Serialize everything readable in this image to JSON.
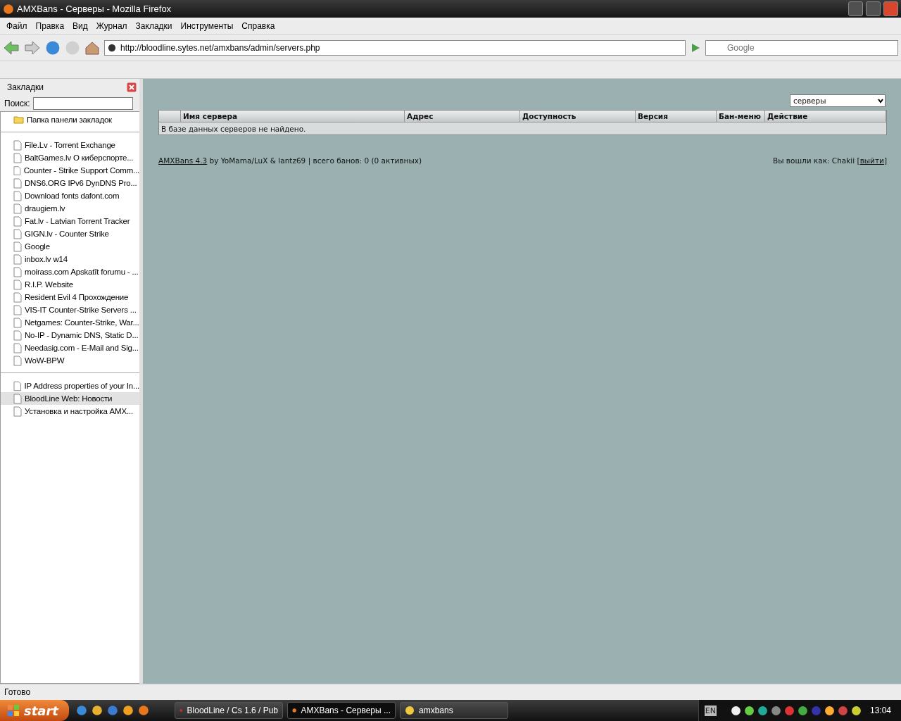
{
  "window": {
    "title": "AMXBans - Серверы - Mozilla Firefox"
  },
  "menu": [
    "Файл",
    "Правка",
    "Вид",
    "Журнал",
    "Закладки",
    "Инструменты",
    "Справка"
  ],
  "address": {
    "value": "http://bloodline.sytes.net/amxbans/admin/servers.php"
  },
  "search": {
    "placeholder": "Google"
  },
  "sidebar": {
    "title": "Закладки",
    "search_label": "Поиск:",
    "groups": [
      [
        {
          "label": "Папка панели закладок",
          "kind": "folder",
          "selected": false
        }
      ],
      [
        {
          "label": "File.Lv - Torrent Exchange",
          "kind": "bookmark",
          "selected": false
        },
        {
          "label": "BaltGames.lv  О киберспорте...",
          "kind": "bookmark",
          "selected": false
        },
        {
          "label": "Counter - Strike Support Comm...",
          "kind": "bookmark",
          "selected": false
        },
        {
          "label": "DNS6.ORG  IPv6 DynDNS Pro...",
          "kind": "bookmark",
          "selected": false
        },
        {
          "label": "Download fonts  dafont.com",
          "kind": "bookmark",
          "selected": false
        },
        {
          "label": "draugiem.lv",
          "kind": "bookmark",
          "selected": false
        },
        {
          "label": "Fat.lv - Latvian Torrent Tracker",
          "kind": "bookmark",
          "selected": false
        },
        {
          "label": "GIGN.lv - Counter Strike",
          "kind": "bookmark",
          "selected": false
        },
        {
          "label": "Google",
          "kind": "bookmark",
          "selected": false
        },
        {
          "label": "inbox.lv w14",
          "kind": "bookmark",
          "selected": false
        },
        {
          "label": "moirass.com  Apskatīt forumu - ...",
          "kind": "bookmark",
          "selected": false
        },
        {
          "label": "R.I.P. Website",
          "kind": "bookmark",
          "selected": false
        },
        {
          "label": "Resident Evil 4 Прохождение",
          "kind": "bookmark",
          "selected": false
        },
        {
          "label": "VIS-IT  Counter-Strike Servers ...",
          "kind": "bookmark",
          "selected": false
        },
        {
          "label": "Netgames: Counter-Strike, War...",
          "kind": "bookmark",
          "selected": false
        },
        {
          "label": "No-IP - Dynamic DNS, Static D...",
          "kind": "bookmark",
          "selected": false
        },
        {
          "label": "Needasig.com - E-Mail and Sig...",
          "kind": "bookmark",
          "selected": false
        },
        {
          "label": "WoW-BPW",
          "kind": "bookmark",
          "selected": false
        }
      ],
      [
        {
          "label": "IP Address properties of your In...",
          "kind": "bookmark",
          "selected": false
        },
        {
          "label": "BloodLine Web: Новости",
          "kind": "bookmark",
          "selected": true
        },
        {
          "label": "Установка и настройка AMX...",
          "kind": "bookmark",
          "selected": false
        }
      ]
    ]
  },
  "page": {
    "select": "серверы",
    "table": {
      "columns": [
        "",
        "Имя сервера",
        "Адрес",
        "Доступность",
        "Версия",
        "Бан-меню",
        "Действие"
      ],
      "empty_message": "В базе данных серверов не найдено."
    },
    "footer": {
      "link": "AMXBans 4.3",
      "text": "by YoMama/LuX & lantz69 | всего банов: 0 (0 активных)",
      "login_text": "Вы вошли как: Chakii [",
      "logout": "выйти",
      "login_end": "]"
    }
  },
  "status_bar": "Готово",
  "taskbar": {
    "start": "start",
    "tasks": [
      {
        "label": "BloodLine / Cs 1.6 / Pub",
        "selected": false
      },
      {
        "label": "AMXBans - Серверы ...",
        "selected": true
      },
      {
        "label": "amxbans",
        "selected": false
      }
    ],
    "language": "EN",
    "clock": "13:04"
  }
}
